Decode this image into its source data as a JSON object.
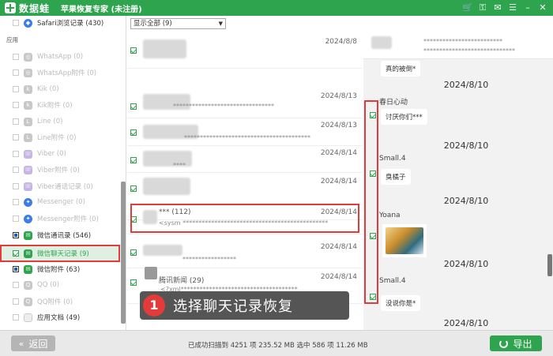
{
  "titlebar": {
    "logo_text": "数据蛙",
    "app_title": "苹果恢复专家 (未注册)"
  },
  "sidebar": {
    "safari_label": "Safari浏览记录 (430)",
    "section_apps": "应用",
    "items": [
      {
        "label": "WhatsApp (0)"
      },
      {
        "label": "WhatsApp附件 (0)"
      },
      {
        "label": "Kik (0)"
      },
      {
        "label": "Kik附件 (0)"
      },
      {
        "label": "Line (0)"
      },
      {
        "label": "Line附件 (0)"
      },
      {
        "label": "Viber (0)"
      },
      {
        "label": "Viber附件 (0)"
      },
      {
        "label": "Viber通话记录 (0)"
      },
      {
        "label": "Messenger (0)"
      },
      {
        "label": "Messenger附件 (0)"
      },
      {
        "label": "微信通讯录 (546)"
      },
      {
        "label": "微信聊天记录 (9)"
      },
      {
        "label": "微信附件 (63)"
      },
      {
        "label": "QQ (0)"
      },
      {
        "label": "QQ附件 (0)"
      },
      {
        "label": "应用文档 (49)"
      }
    ]
  },
  "middle": {
    "filter_value": "显示全部 (9)",
    "rows": [
      {
        "date": "2024/8/8",
        "text": ""
      },
      {
        "date": "2024/8/13",
        "text": "********************************"
      },
      {
        "date": "2024/8/13",
        "text": "****************************************"
      },
      {
        "date": "2024/8/14",
        "text": "****"
      },
      {
        "date": "2024/8/14",
        "text": ""
      },
      {
        "date": "2024/8/14",
        "name": "*** (112)",
        "text": "<sysm **********************************************"
      },
      {
        "date": "2024/8/14",
        "text": "*****************"
      },
      {
        "date": "2024/8/14",
        "name": "腾讯新闻 (29)",
        "text": "<?xml*************************************"
      }
    ]
  },
  "chat": {
    "header_stars1": "*************************",
    "header_stars2": "*****************************",
    "msg0": "真的被倒*",
    "dates": [
      "2024/8/10",
      "2024/8/10",
      "2024/8/10",
      "2024/8/10",
      "2024/8/10"
    ],
    "senders": [
      "春日心动",
      "Small.4",
      "Yoana",
      "Small.4"
    ],
    "msgs": [
      "讨厌你们***",
      "臭橘子",
      "没说你是*"
    ]
  },
  "overlay": {
    "step_number": "1",
    "step_text": "选择聊天记录恢复"
  },
  "footer": {
    "back_label": "返回",
    "status": "已成功扫描到 4251 项 235.52 MB  选中 586 项 11.26 MB",
    "export_label": "导出"
  },
  "colors": {
    "brand": "#2ea44f",
    "highlight": "#e03c3c"
  }
}
